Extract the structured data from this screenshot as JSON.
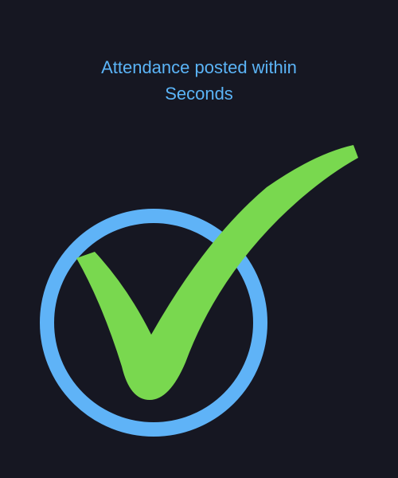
{
  "message": {
    "line1": "Attendance posted within",
    "line2": "Seconds"
  },
  "icons": {
    "ring": "circle-outline-icon",
    "check": "checkmark-icon"
  },
  "colors": {
    "background": "#161722",
    "text": "#5bb4f7",
    "ring": "#5fb3f7",
    "check": "#79d84f"
  }
}
